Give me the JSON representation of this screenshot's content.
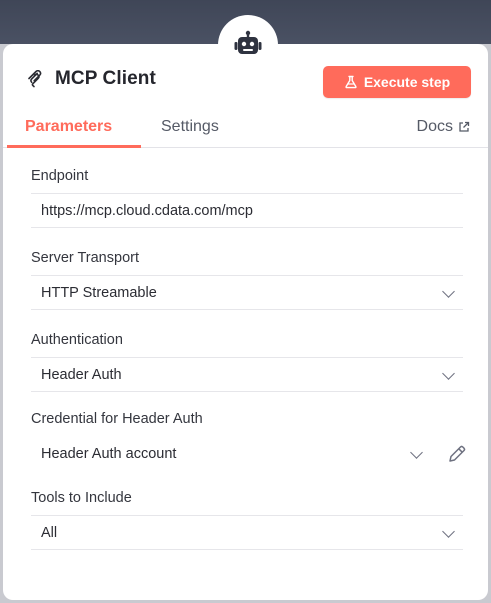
{
  "node": {
    "icon": "robot-icon",
    "title": "MCP Client",
    "title_icon": "mcp-logo-icon"
  },
  "toolbar": {
    "execute_label": "Execute step",
    "execute_icon": "flask-icon",
    "accent_color": "#ff6b5b"
  },
  "tabs": [
    {
      "label": "Parameters",
      "active": true
    },
    {
      "label": "Settings",
      "active": false
    }
  ],
  "docs": {
    "label": "Docs",
    "icon": "external-link-icon"
  },
  "fields": {
    "endpoint": {
      "label": "Endpoint",
      "value": "https://mcp.cloud.cdata.com/mcp"
    },
    "server_transport": {
      "label": "Server Transport",
      "value": "HTTP Streamable"
    },
    "authentication": {
      "label": "Authentication",
      "value": "Header Auth"
    },
    "credential": {
      "label": "Credential for Header Auth",
      "value": "Header Auth account",
      "edit_icon": "pencil-icon"
    },
    "tools": {
      "label": "Tools to Include",
      "value": "All"
    }
  }
}
